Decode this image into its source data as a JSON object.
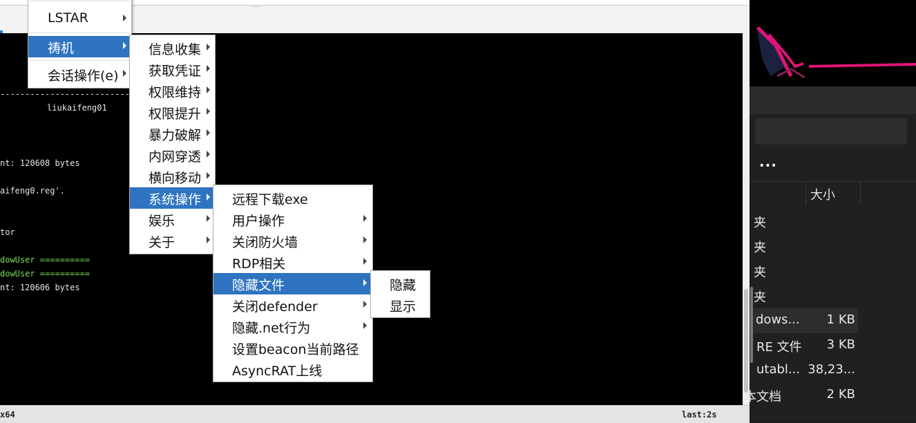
{
  "console": {
    "separator": "------------------------------",
    "lines": [
      {
        "text": "liukaifeng01",
        "color": "white"
      },
      {
        "text": "nt: 120608 bytes",
        "color": "white"
      },
      {
        "text": "aifeng0.reg'.",
        "color": "white"
      },
      {
        "text": "tor",
        "color": "white"
      },
      {
        "text": "dowUser ==========",
        "color": "green"
      },
      {
        "text": "dowUser ==========",
        "color": "green"
      },
      {
        "text": "nt: 120606 bytes",
        "color": "white"
      }
    ],
    "split_grip": "..."
  },
  "statusbar": {
    "left": "x64",
    "right": "last:2s"
  },
  "menu_main": {
    "items": [
      {
        "label": "LSTAR",
        "submenu": true,
        "active": false
      },
      {
        "label": "祷机",
        "submenu": true,
        "active": true
      },
      {
        "label": "会话操作(e)",
        "submenu": true,
        "active": false
      }
    ]
  },
  "menu_sub1": {
    "items": [
      {
        "label": "信息收集",
        "submenu": true
      },
      {
        "label": "获取凭证",
        "submenu": true
      },
      {
        "label": "权限维持",
        "submenu": true
      },
      {
        "label": "权限提升",
        "submenu": true
      },
      {
        "label": "暴力破解",
        "submenu": true
      },
      {
        "label": "内网穿透",
        "submenu": true
      },
      {
        "label": "横向移动",
        "submenu": true
      },
      {
        "label": "系统操作",
        "submenu": true,
        "active": true
      },
      {
        "label": "娱乐",
        "submenu": true
      },
      {
        "label": "关于",
        "submenu": true
      }
    ]
  },
  "menu_sub2": {
    "items": [
      {
        "label": "远程下载exe",
        "submenu": false
      },
      {
        "label": "用户操作",
        "submenu": true
      },
      {
        "label": "关闭防火墙",
        "submenu": true
      },
      {
        "label": "RDP相关",
        "submenu": true
      },
      {
        "label": "隐藏文件",
        "submenu": true,
        "active": true
      },
      {
        "label": "关闭defender",
        "submenu": true
      },
      {
        "label": "隐藏.net行为",
        "submenu": true
      },
      {
        "label": "设置beacon当前路径",
        "submenu": false
      },
      {
        "label": "AsyncRAT上线",
        "submenu": false
      }
    ]
  },
  "menu_sub3": {
    "items": [
      {
        "label": "隐藏"
      },
      {
        "label": "显示"
      }
    ]
  },
  "explorer": {
    "more": "...",
    "column_size": "大小",
    "rows": [
      {
        "name": "夹",
        "size": ""
      },
      {
        "name": "夹",
        "size": ""
      },
      {
        "name": "夹",
        "size": ""
      },
      {
        "name": "夹",
        "size": ""
      },
      {
        "name": "dows...",
        "size": "1 KB",
        "selected": true
      },
      {
        "name": "RE 文件",
        "size": "3 KB"
      },
      {
        "name": "utabl...",
        "size": "38,23..."
      },
      {
        "name": "本文档",
        "size": "2 KB"
      }
    ]
  },
  "colors": {
    "menu_highlight": "#2e74c0",
    "console_bg": "#000000",
    "console_green": "#7cdc5a",
    "wallpaper_accent": "#e0147a"
  }
}
